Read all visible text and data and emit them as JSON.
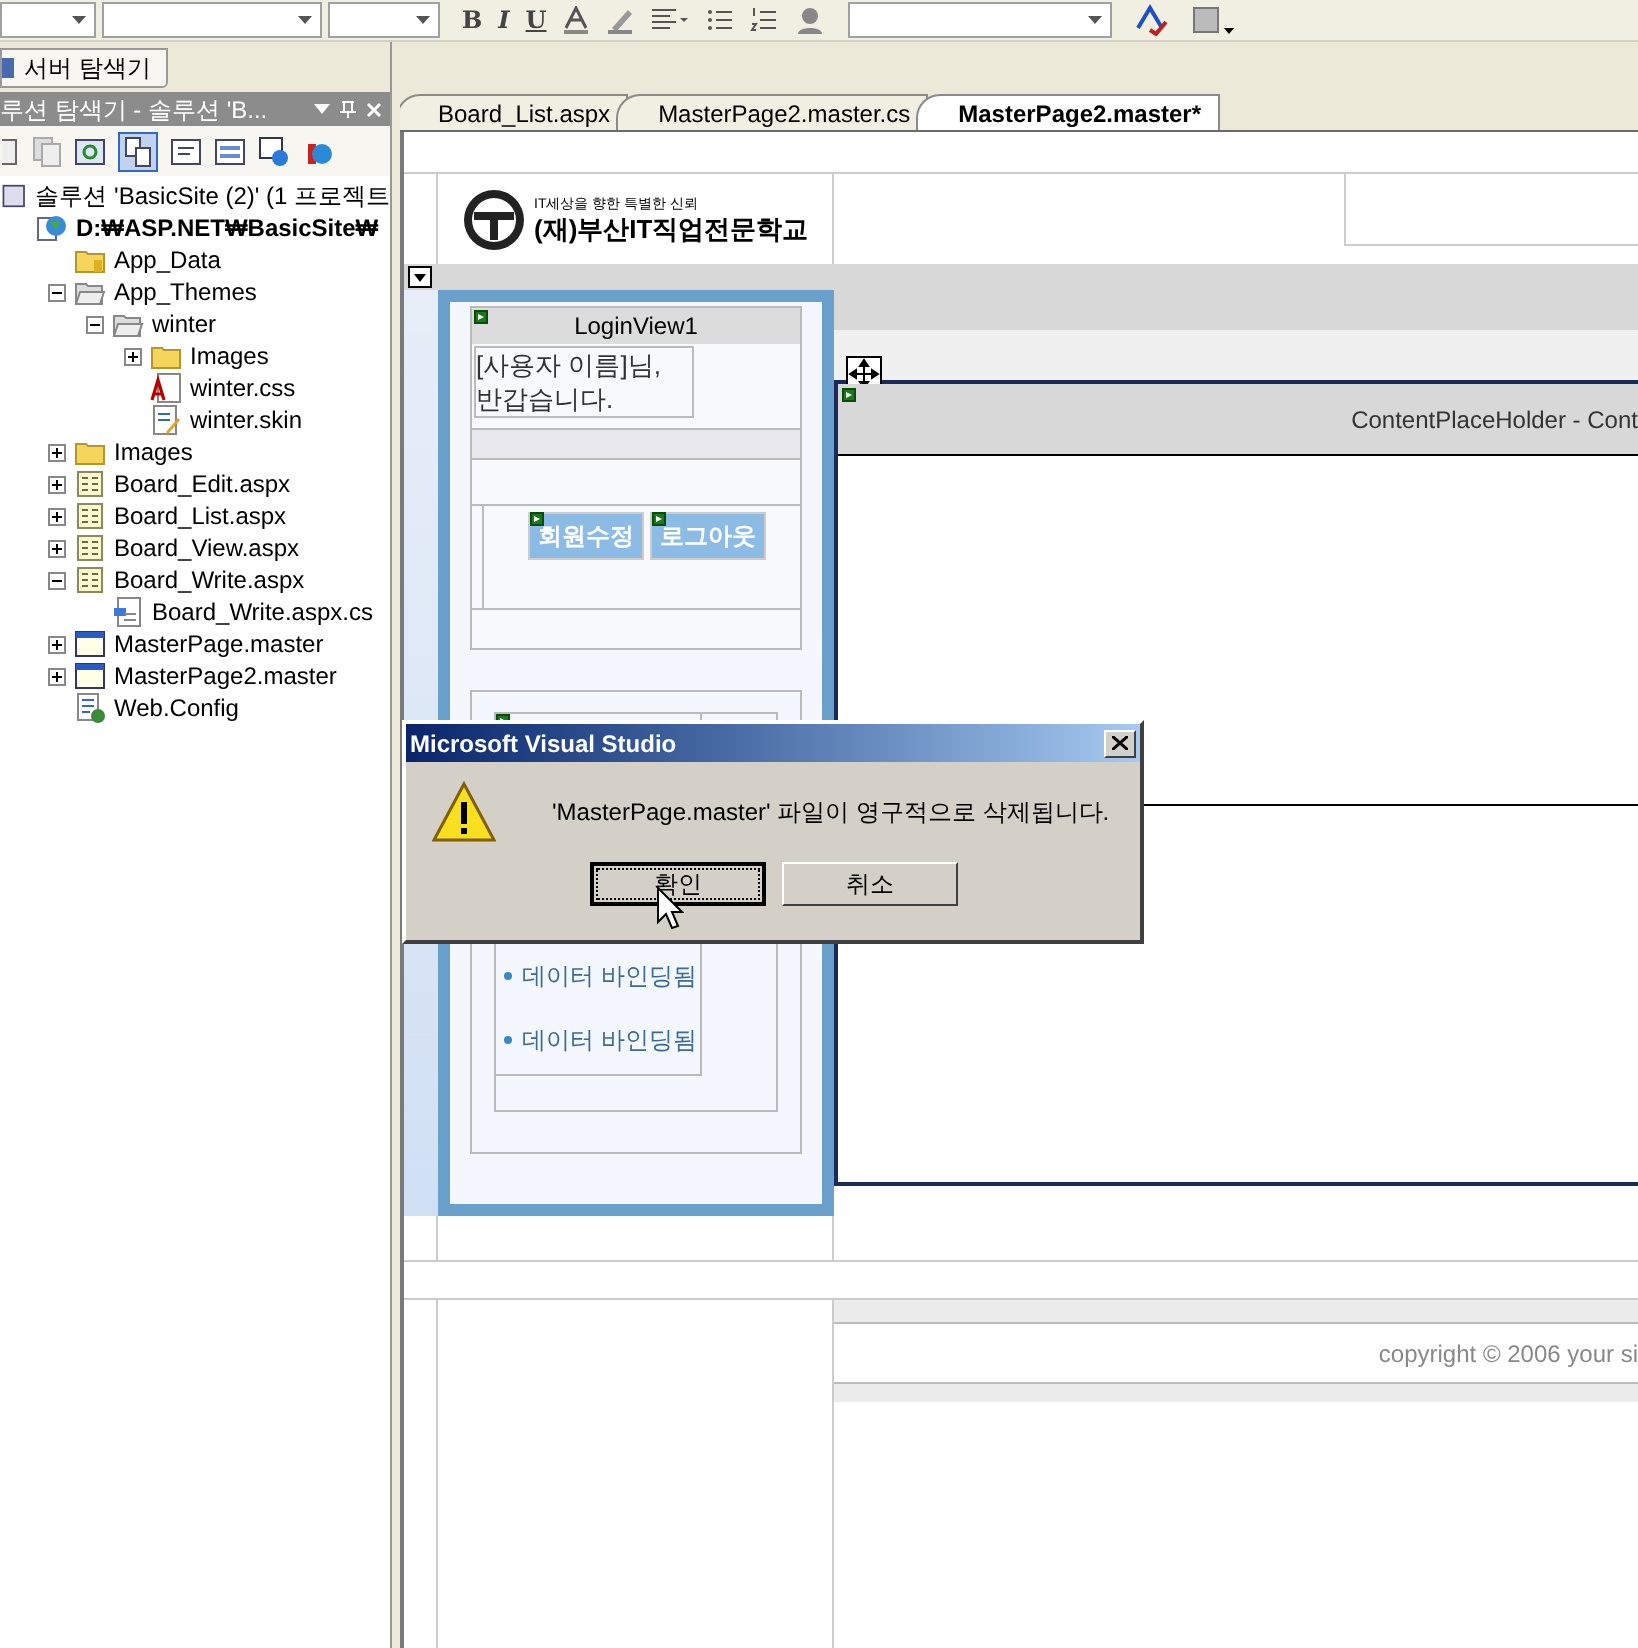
{
  "toolbar": {
    "format_buttons": [
      "B",
      "I",
      "U"
    ]
  },
  "server_explorer_tab": "서버 탐색기",
  "solution_explorer": {
    "title": "루션 탐색기 - 솔루션 'B...",
    "tree": [
      {
        "label": "솔루션 'BasicSite (2)' (1 프로젝트",
        "kind": "solution",
        "children": [
          {
            "label": "D:₩ASP.NET₩BasicSite₩",
            "kind": "project",
            "children": [
              {
                "label": "App_Data",
                "kind": "data"
              },
              {
                "label": "App_Themes",
                "kind": "openfolder",
                "expanded": true,
                "children": [
                  {
                    "label": "winter",
                    "kind": "openfolder",
                    "expanded": true,
                    "children": [
                      {
                        "label": "Images",
                        "kind": "folder",
                        "expanded": false
                      },
                      {
                        "label": "winter.css",
                        "kind": "css"
                      },
                      {
                        "label": "winter.skin",
                        "kind": "skin"
                      }
                    ]
                  }
                ]
              },
              {
                "label": "Images",
                "kind": "folder",
                "expanded": false
              },
              {
                "label": "Board_Edit.aspx",
                "kind": "aspx",
                "expanded": false
              },
              {
                "label": "Board_List.aspx",
                "kind": "aspx",
                "expanded": false
              },
              {
                "label": "Board_View.aspx",
                "kind": "aspx",
                "expanded": false
              },
              {
                "label": "Board_Write.aspx",
                "kind": "aspx",
                "expanded": true,
                "children": [
                  {
                    "label": "Board_Write.aspx.cs",
                    "kind": "cs"
                  }
                ]
              },
              {
                "label": "MasterPage.master",
                "kind": "master",
                "expanded": false
              },
              {
                "label": "MasterPage2.master",
                "kind": "master",
                "expanded": false
              },
              {
                "label": "Web.Config",
                "kind": "config"
              }
            ]
          }
        ]
      }
    ]
  },
  "tabs": [
    {
      "label": "Board_List.aspx",
      "selected": false
    },
    {
      "label": "MasterPage2.master.cs",
      "selected": false
    },
    {
      "label": "MasterPage2.master*",
      "selected": true
    }
  ],
  "designer": {
    "logo": {
      "tagline": "IT세상을 향한 특별한 신뢰",
      "name": "(재)부산IT직업전문학교"
    },
    "login_view": {
      "title": "LoginView1",
      "greeting": "[사용자 이름]님, 반갑습니다.",
      "buttons": [
        "회원수정",
        "로그아웃"
      ]
    },
    "list_items": [
      "데이터 바인딩됨",
      "데이터 바인딩됨"
    ],
    "content_placeholder": "ContentPlaceHolder - Cont",
    "footer": "copyright © 2006 your si"
  },
  "dialog": {
    "title": "Microsoft Visual Studio",
    "message": "'MasterPage.master' 파일이 영구적으로 삭제됩니다.",
    "buttons": [
      {
        "label": "확인",
        "focused": true
      },
      {
        "label": "취소",
        "focused": false
      }
    ]
  }
}
